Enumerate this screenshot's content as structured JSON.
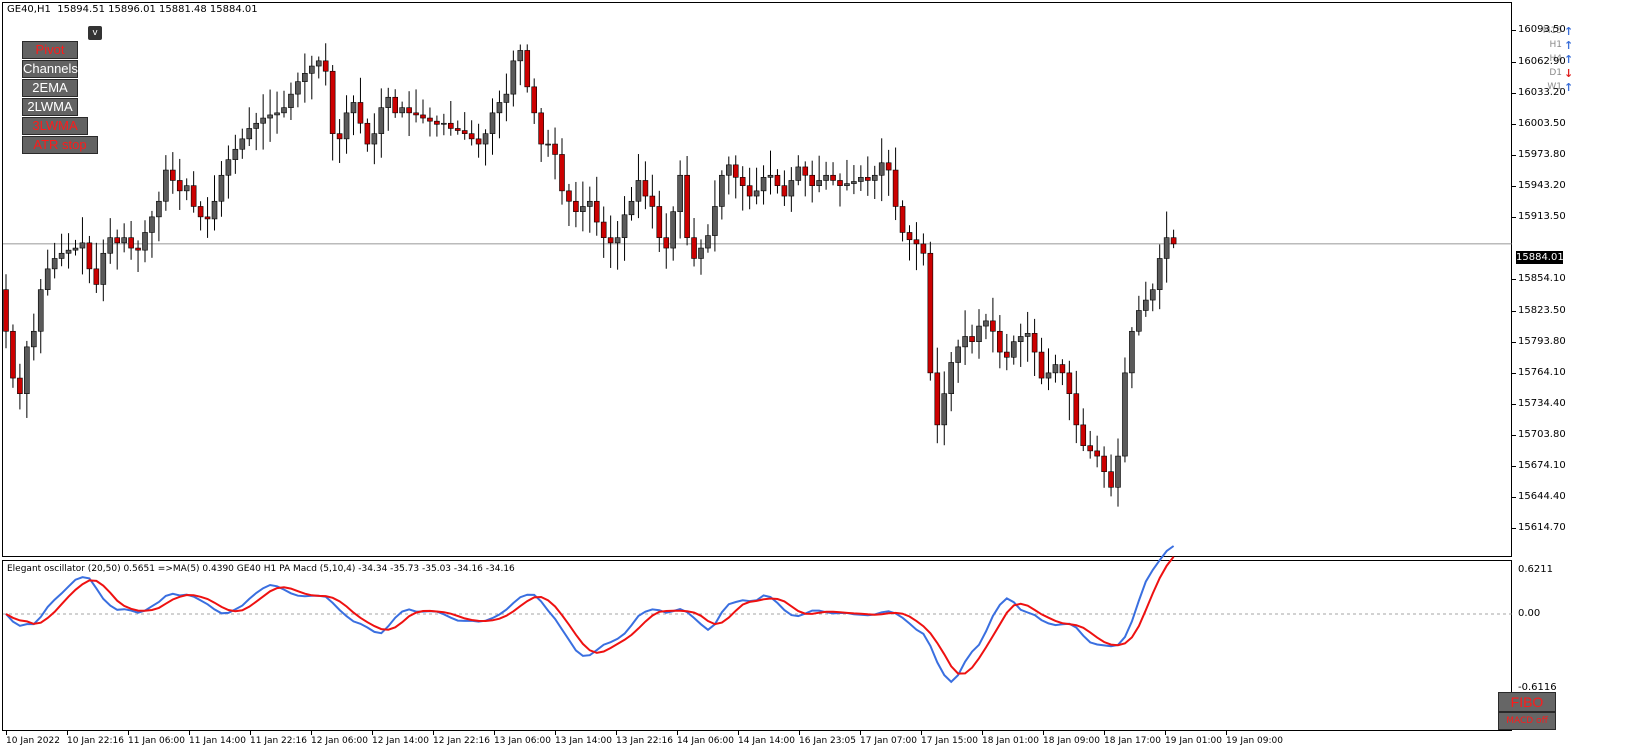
{
  "chart_header": {
    "symbol": "GE40,H1",
    "ohlc": "15894.51 15896.01 15881.48 15884.01"
  },
  "v_button": "v",
  "indicator_buttons": [
    {
      "label": "Pivot",
      "color": "#ff1a1a"
    },
    {
      "label": "Channels",
      "color": "#ffffff"
    },
    {
      "label": "2EMA",
      "color": "#ffffff"
    },
    {
      "label": "2LWMA",
      "color": "#ffffff"
    },
    {
      "label": "3LWMA",
      "color": "#ff1a1a"
    },
    {
      "label": "ATR stop",
      "color": "#ff1a1a"
    }
  ],
  "timeframe_trend": [
    {
      "label": "M15",
      "direction": "up",
      "icon": "arrow-up-icon",
      "color": "#3b6fd8"
    },
    {
      "label": "H1",
      "direction": "up",
      "icon": "arrow-up-icon",
      "color": "#3b6fd8"
    },
    {
      "label": "H4",
      "direction": "up",
      "icon": "arrow-up-icon",
      "color": "#3b6fd8"
    },
    {
      "label": "D1",
      "direction": "down",
      "icon": "arrow-down-icon",
      "color": "#e02020"
    },
    {
      "label": "W1",
      "direction": "up",
      "icon": "arrow-up-icon",
      "color": "#3b6fd8"
    }
  ],
  "price_axis_labels": [
    "16093.50",
    "16062.90",
    "16033.20",
    "16003.50",
    "15973.80",
    "15943.20",
    "15913.50",
    "15854.10",
    "15823.50",
    "15793.80",
    "15764.10",
    "15734.40",
    "15703.80",
    "15674.10",
    "15644.40",
    "15614.70"
  ],
  "current_price": "15884.01",
  "oscillator": {
    "header": "Elegant oscillator (20,50) 0.5651  =>MA(5) 0.4390  GE40 H1 PA Macd (5,10,4) -34.34 -35.73 -35.03 -34.16 -34.16",
    "axis_labels": [
      "0.6211",
      "0.00",
      "-0.6116"
    ]
  },
  "time_axis_labels": [
    "10 Jan 2022",
    "10 Jan 22:16",
    "11 Jan 06:00",
    "11 Jan 14:00",
    "11 Jan 22:16",
    "12 Jan 06:00",
    "12 Jan 14:00",
    "12 Jan 22:16",
    "13 Jan 06:00",
    "13 Jan 14:00",
    "13 Jan 22:16",
    "14 Jan 06:00",
    "14 Jan 14:00",
    "16 Jan 23:05",
    "17 Jan 07:00",
    "17 Jan 15:00",
    "18 Jan 01:00",
    "18 Jan 09:00",
    "18 Jan 17:00",
    "19 Jan 01:00",
    "19 Jan 09:00"
  ],
  "fibo_button": "FIBO",
  "macd_button": "MACD off",
  "colors": {
    "bull": "#5a5a5a",
    "bear": "#cc0000",
    "osc_blue": "#3a6fe0",
    "osc_red": "#ee1111"
  },
  "chart_data": {
    "type": "candlestick",
    "symbol": "GE40",
    "timeframe": "H1",
    "ylim": [
      15614.7,
      16108
    ],
    "closes": [
      15800,
      15755,
      15740,
      15785,
      15800,
      15840,
      15860,
      15870,
      15875,
      15878,
      15880,
      15885,
      15860,
      15845,
      15875,
      15890,
      15885,
      15890,
      15880,
      15878,
      15895,
      15910,
      15925,
      15955,
      15945,
      15935,
      15940,
      15920,
      15910,
      15908,
      15925,
      15950,
      15965,
      15975,
      15985,
      15995,
      16000,
      16005,
      16008,
      16010,
      16015,
      16028,
      16040,
      16048,
      16055,
      16060,
      16050,
      15990,
      15985,
      16010,
      16020,
      16000,
      15980,
      15990,
      16015,
      16025,
      16010,
      16015,
      16010,
      16008,
      16005,
      16002,
      15999,
      16000,
      15995,
      15993,
      15990,
      15985,
      15980,
      15990,
      16010,
      16020,
      16028,
      16060,
      16070,
      16035,
      16010,
      15980,
      15980,
      15970,
      15935,
      15925,
      15915,
      15920,
      15925,
      15905,
      15890,
      15885,
      15890,
      15912,
      15925,
      15945,
      15930,
      15920,
      15890,
      15880,
      15915,
      15950,
      15890,
      15870,
      15880,
      15892,
      15920,
      15950,
      15960,
      15948,
      15940,
      15930,
      15935,
      15948,
      15950,
      15940,
      15930,
      15945,
      15958,
      15950,
      15940,
      15945,
      15950,
      15945,
      15940,
      15942,
      15944,
      15948,
      15945,
      15950,
      15962,
      15955,
      15920,
      15895,
      15888,
      15884,
      15875,
      15760,
      15710,
      15740,
      15770,
      15785,
      15795,
      15790,
      15805,
      15810,
      15800,
      15780,
      15775,
      15790,
      15795,
      15798,
      15780,
      15755,
      15760,
      15768,
      15760,
      15740,
      15710,
      15690,
      15685,
      15680,
      15665,
      15650,
      15680,
      15760,
      15800,
      15820,
      15830,
      15840,
      15870,
      15890,
      15884
    ]
  }
}
